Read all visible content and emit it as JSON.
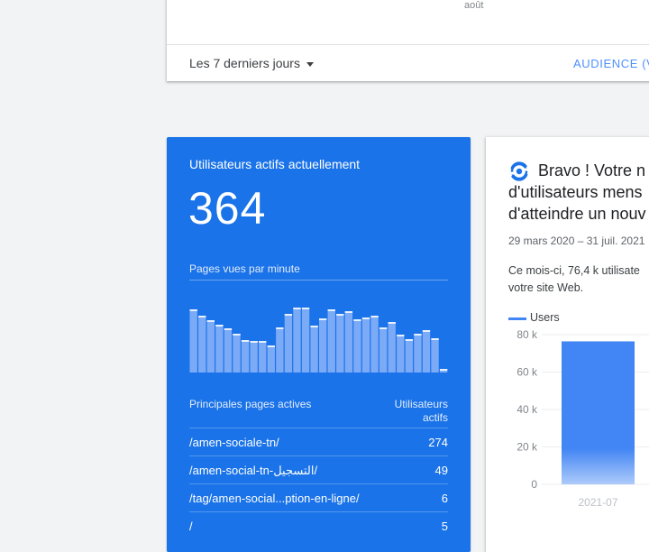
{
  "top_card": {
    "axis_label": "août",
    "date_range": "Les 7 derniers jours",
    "audience_link": "AUDIENCE (V"
  },
  "realtime": {
    "title": "Utilisateurs actifs actuellement",
    "active_users": "364",
    "ppm_label": "Pages vues par minute",
    "ppm_values": [
      70,
      63,
      58,
      53,
      49,
      43,
      36,
      35,
      35,
      30,
      50,
      65,
      72,
      72,
      52,
      60,
      70,
      65,
      68,
      59,
      61,
      63,
      50,
      56,
      42,
      37,
      43,
      47,
      38,
      4
    ],
    "pages_header": "Principales pages actives",
    "users_header_line1": "Utilisateurs",
    "users_header_line2": "actifs",
    "pages": [
      {
        "path": "/amen-sociale-tn/",
        "users": "274"
      },
      {
        "path": "/amen-social-tn-التسجيل/",
        "users": "49"
      },
      {
        "path": "/tag/amen-social...ption-en-ligne/",
        "users": "6"
      },
      {
        "path": "/",
        "users": "5"
      }
    ]
  },
  "insight": {
    "icon": "insights-icon",
    "headline_line1": "Bravo ! Votre n",
    "headline_line2": "d'utilisateurs mens",
    "headline_line3": "d'atteindre un nouv",
    "date_range": "29 mars 2020 – 31 juil. 2021",
    "desc_line1": "Ce mois-ci, 76,4 k utilisate",
    "desc_line2": "votre site Web.",
    "legend": "Users"
  },
  "chart_data": {
    "type": "bar",
    "categories": [
      "2021-07"
    ],
    "series": [
      {
        "name": "Users",
        "values": [
          76400
        ]
      }
    ],
    "yticks": [
      "0",
      "20 k",
      "40 k",
      "60 k",
      "80 k"
    ],
    "ylim": [
      0,
      80000
    ],
    "color": "#4285f4"
  },
  "colors": {
    "accent": "#1a73e8",
    "link": "#4d90fe"
  }
}
